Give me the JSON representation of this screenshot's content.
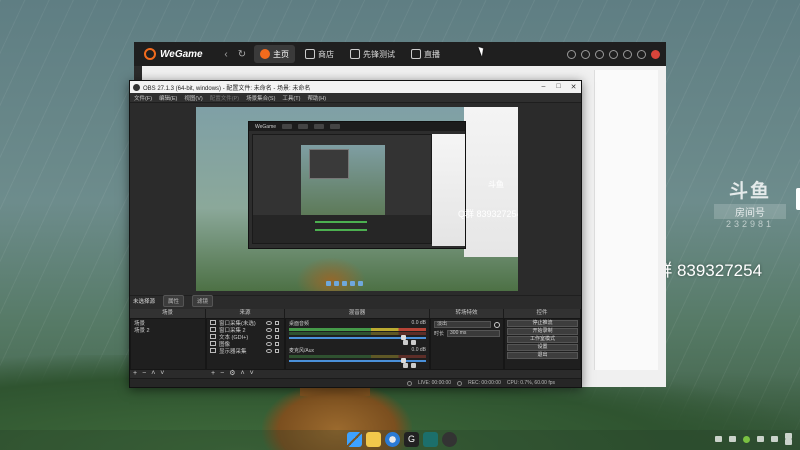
{
  "desktop": {
    "douyu": {
      "logo": "斗鱼",
      "room_label": "房间号",
      "room_number": "232981"
    },
    "qq_group": "Q群 839327254"
  },
  "wegame": {
    "brand": "WeGame",
    "tabs": [
      {
        "label": "主页"
      },
      {
        "label": "商店"
      },
      {
        "label": "先锋测试"
      },
      {
        "label": "直播"
      }
    ]
  },
  "obs": {
    "title": "OBS 27.1.3 (64-bit, windows) - 配置文件: 未命名 - 场景: 未命名",
    "menu": [
      "文件(F)",
      "编辑(E)",
      "视图(V)",
      "配置文件(P)",
      "场景集合(S)",
      "工具(T)",
      "帮助(H)"
    ],
    "status_text": "未选择源",
    "status_buttons": [
      "属性",
      "滤镜"
    ],
    "docks": {
      "scenes": "场景",
      "sources": "来源",
      "mixer": "混音器",
      "transitions": "转场特效",
      "controls": "控件"
    },
    "scenes": [
      "场景",
      "场景 2"
    ],
    "sources": [
      {
        "name": "窗口采集(未选)"
      },
      {
        "name": "窗口采集 2"
      },
      {
        "name": "文本 (GDI+)"
      },
      {
        "name": "图像"
      },
      {
        "name": "显示器采集"
      }
    ],
    "mixer": [
      {
        "name": "桌面音频",
        "level": "0.0 dB"
      },
      {
        "name": "麦克风/Aux",
        "level": "0.0 dB"
      }
    ],
    "transition": {
      "type": "淡出",
      "duration_label": "时长",
      "duration": "300 ms"
    },
    "controls": [
      "停止推流",
      "开始录制",
      "工作室模式",
      "设置",
      "退出"
    ],
    "footer": {
      "live": "LIVE: 00:00:00",
      "rec": "REC: 00:00:00",
      "cpu": "CPU: 0.7%, 60.00 fps"
    }
  },
  "colors": {
    "obs_bg": "#2b2b2b",
    "wegame_accent": "#f26b1d",
    "selection": "#3e6ea0"
  }
}
